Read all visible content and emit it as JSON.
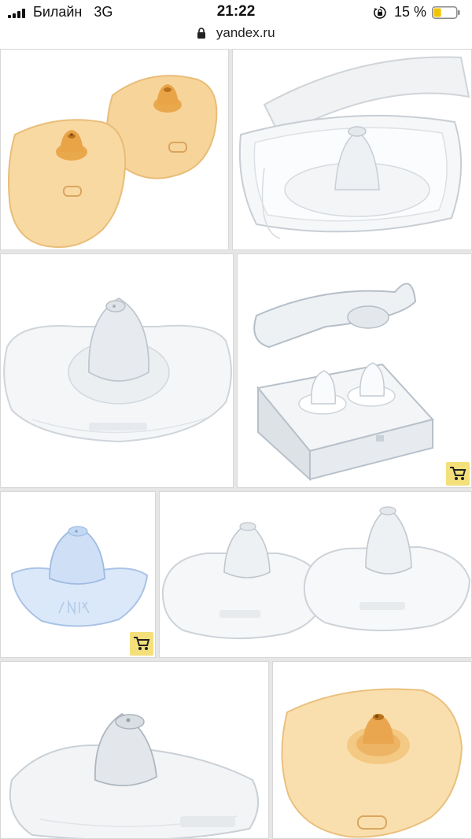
{
  "status_bar": {
    "carrier": "Билайн",
    "network": "3G",
    "time": "21:22",
    "battery_percent": "15 %",
    "battery_level": 0.15
  },
  "browser": {
    "url": "yandex.ru"
  },
  "images": [
    {
      "icon": "chicco-nipple-shields-pair",
      "has_cart": false
    },
    {
      "icon": "clear-nipple-shield-in-case",
      "has_cart": false
    },
    {
      "icon": "medela-nipple-shield",
      "has_cart": false
    },
    {
      "icon": "nipple-shields-in-open-case",
      "has_cart": true
    },
    {
      "icon": "nuk-nipple-shield",
      "has_cart": true
    },
    {
      "icon": "medela-nipple-shields-pair",
      "has_cart": false
    },
    {
      "icon": "avent-nipple-shield",
      "has_cart": false
    },
    {
      "icon": "chicco-nipple-shield",
      "has_cart": false
    }
  ],
  "colors": {
    "cart_badge": "#f4e07a",
    "battery_low": "#f2c300",
    "grid_gap": "#e6e6e6"
  }
}
